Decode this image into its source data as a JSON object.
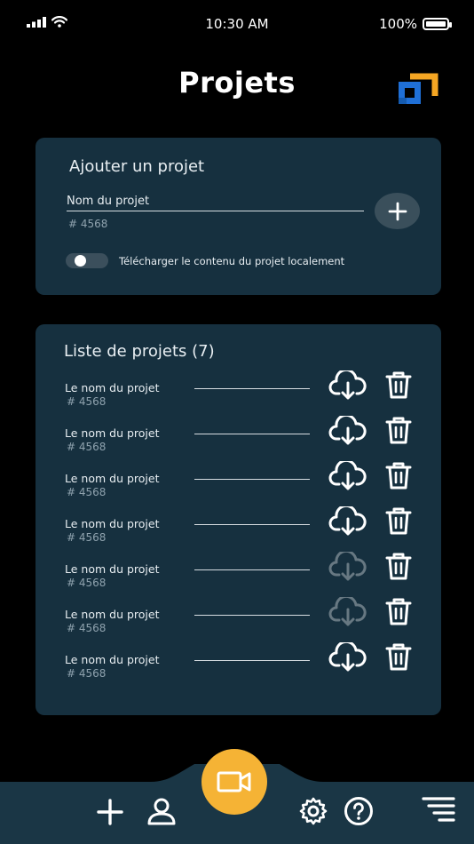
{
  "status_bar": {
    "time": "10:30 AM",
    "battery": "100%",
    "battery_level": 1.0
  },
  "header": {
    "title": "Projets"
  },
  "add_project": {
    "title": "Ajouter un projet",
    "name_placeholder": "Nom du projet",
    "project_id": "# 4568",
    "toggle_label": "Télécharger le contenu du projet localement",
    "toggle_on": false
  },
  "project_list": {
    "title": "Liste de projets (7)",
    "items": [
      {
        "name": "Le nom du projet",
        "id": "# 4568",
        "download_enabled": true
      },
      {
        "name": "Le nom du projet",
        "id": "# 4568",
        "download_enabled": true
      },
      {
        "name": "Le nom du projet",
        "id": "# 4568",
        "download_enabled": true
      },
      {
        "name": "Le nom du projet",
        "id": "# 4568",
        "download_enabled": true
      },
      {
        "name": "Le nom du projet",
        "id": "# 4568",
        "download_enabled": false
      },
      {
        "name": "Le nom du projet",
        "id": "# 4568",
        "download_enabled": false
      },
      {
        "name": "Le nom du projet",
        "id": "# 4568",
        "download_enabled": true
      }
    ]
  },
  "bottom_nav": {
    "icons": [
      "plus-icon",
      "user-icon",
      "video-camera-icon",
      "gear-icon",
      "help-icon",
      "filter-icon"
    ]
  },
  "colors": {
    "background": "#000000",
    "card": "#16303f",
    "accent": "#f5b335",
    "bottom_bar": "#1a3645",
    "logo_blue": "#1f6fd6",
    "logo_orange": "#f5a623"
  }
}
